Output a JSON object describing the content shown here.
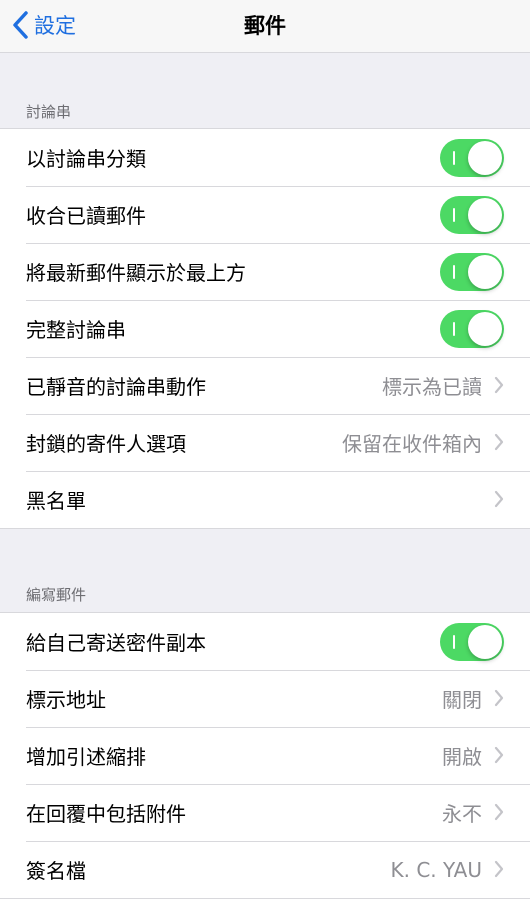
{
  "nav": {
    "back_label": "設定",
    "title": "郵件"
  },
  "sections": [
    {
      "header": "討論串",
      "rows": [
        {
          "label": "以討論串分類",
          "type": "toggle",
          "on": true
        },
        {
          "label": "收合已讀郵件",
          "type": "toggle",
          "on": true
        },
        {
          "label": "將最新郵件顯示於最上方",
          "type": "toggle",
          "on": true
        },
        {
          "label": "完整討論串",
          "type": "toggle",
          "on": true
        },
        {
          "label": "已靜音的討論串動作",
          "type": "detail",
          "value": "標示為已讀"
        },
        {
          "label": "封鎖的寄件人選項",
          "type": "detail",
          "value": "保留在收件箱內"
        },
        {
          "label": "黑名單",
          "type": "detail",
          "value": ""
        }
      ]
    },
    {
      "header": "編寫郵件",
      "rows": [
        {
          "label": "給自己寄送密件副本",
          "type": "toggle",
          "on": true
        },
        {
          "label": "標示地址",
          "type": "detail",
          "value": "關閉"
        },
        {
          "label": "增加引述縮排",
          "type": "detail",
          "value": "開啟"
        },
        {
          "label": "在回覆中包括附件",
          "type": "detail",
          "value": "永不"
        },
        {
          "label": "簽名檔",
          "type": "detail",
          "value": "K. C. YAU"
        }
      ]
    }
  ],
  "colors": {
    "accent": "#1f6fe0",
    "toggle_on": "#4cd964",
    "background": "#efeff4"
  }
}
